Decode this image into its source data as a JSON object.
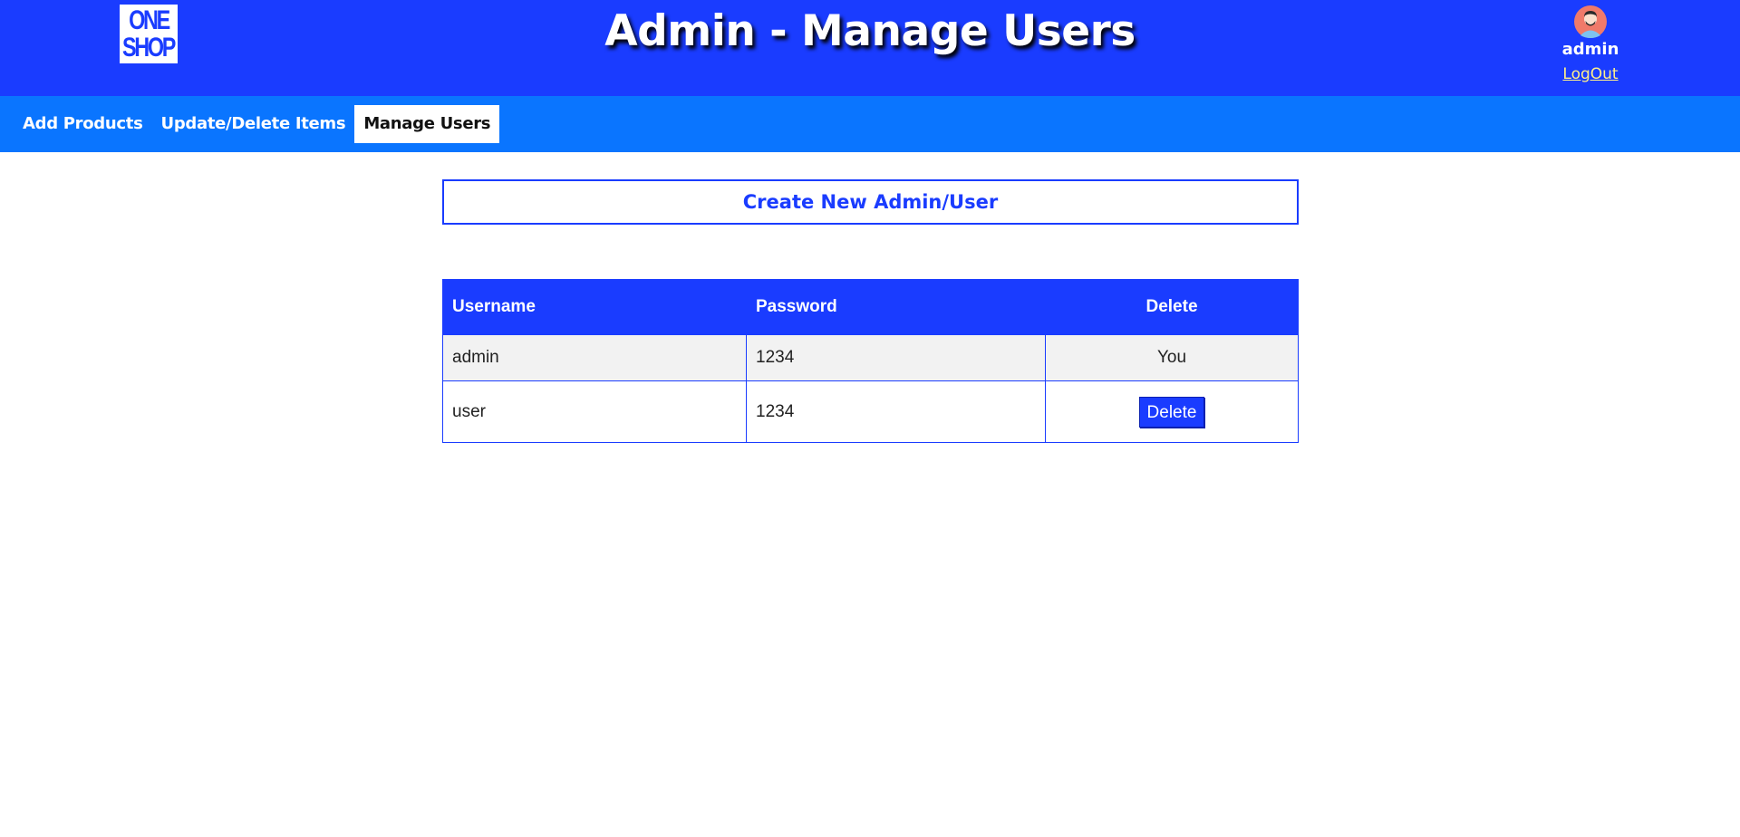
{
  "header": {
    "logo_line1": "ONE",
    "logo_line2": "SHOP",
    "title": "Admin - Manage Users",
    "user": {
      "name": "admin",
      "logout_label": "LogOut",
      "avatar_icon": "user-avatar-icon"
    }
  },
  "nav": {
    "items": [
      {
        "label": "Add Products",
        "active": false
      },
      {
        "label": "Update/Delete Items",
        "active": false
      },
      {
        "label": "Manage Users",
        "active": true
      }
    ]
  },
  "main": {
    "create_button_label": "Create New Admin/User",
    "table": {
      "columns": [
        "Username",
        "Password",
        "Delete"
      ],
      "rows": [
        {
          "username": "admin",
          "password": "1234",
          "delete": "You"
        },
        {
          "username": "user",
          "password": "1234",
          "delete": "Delete"
        }
      ]
    }
  },
  "colors": {
    "header_bg": "#1a3cff",
    "nav_bg": "#0a75ff",
    "logout_link": "#ffef8a",
    "table_row_alt": "#f2f2f2"
  }
}
